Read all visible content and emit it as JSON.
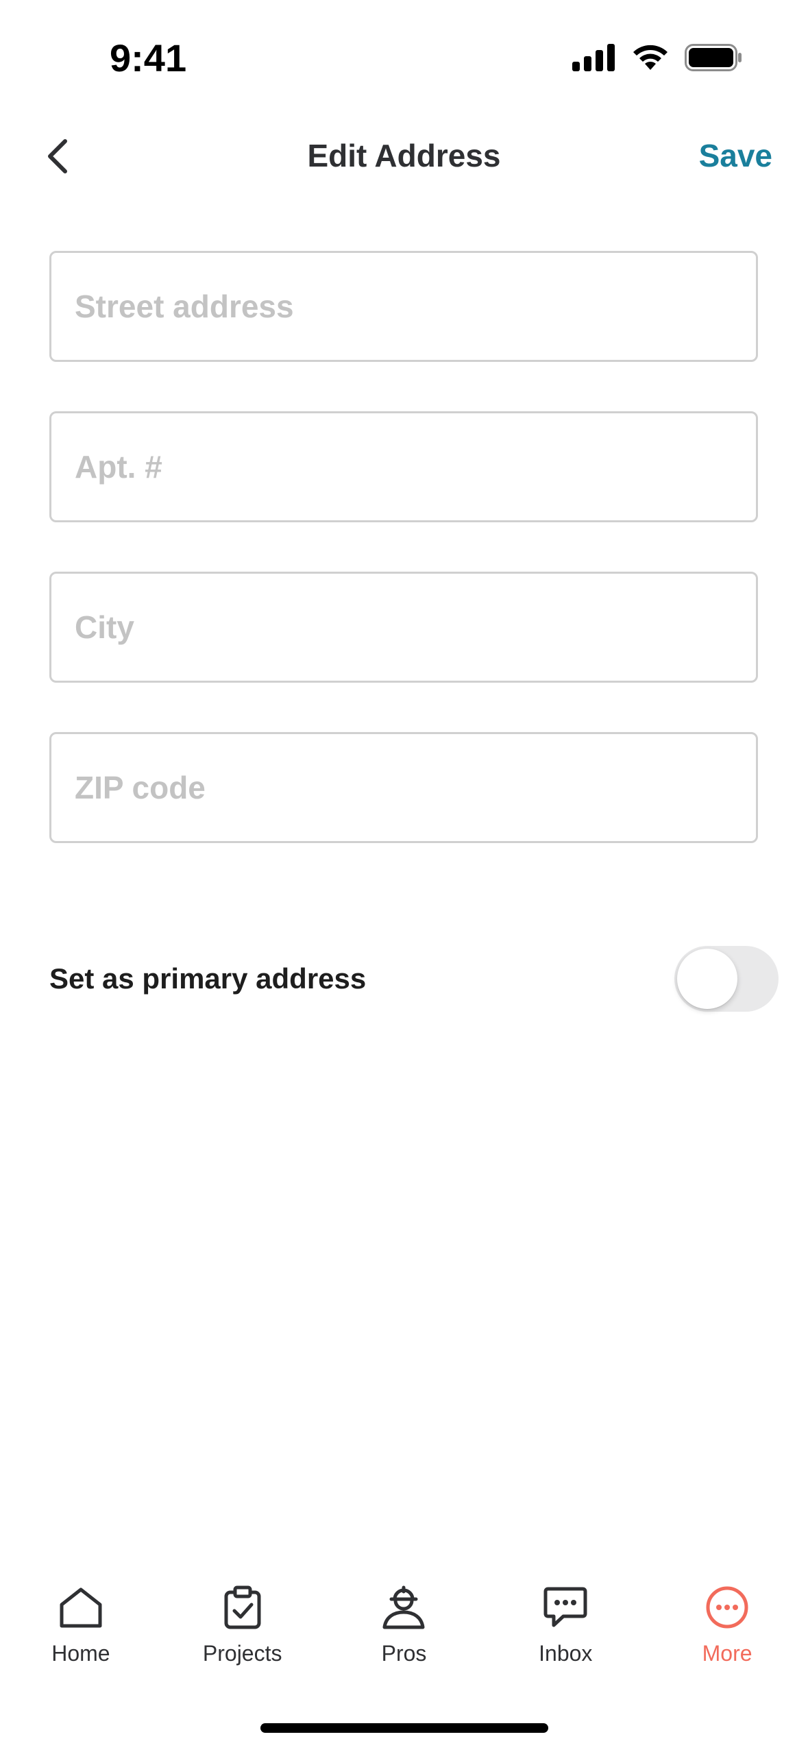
{
  "status_bar": {
    "time": "9:41",
    "icons": [
      "cellular-signal-icon",
      "wifi-icon",
      "battery-icon"
    ]
  },
  "nav": {
    "back_icon": "chevron-left-icon",
    "title": "Edit Address",
    "save_label": "Save"
  },
  "form": {
    "street": {
      "value": "",
      "placeholder": "Street address"
    },
    "apt": {
      "value": "",
      "placeholder": "Apt. #"
    },
    "city": {
      "value": "",
      "placeholder": "City"
    },
    "zip": {
      "value": "",
      "placeholder": "ZIP code"
    }
  },
  "primary_toggle": {
    "label": "Set as primary address",
    "on": false
  },
  "tabs": [
    {
      "label": "Home",
      "icon": "home-icon",
      "active": false
    },
    {
      "label": "Projects",
      "icon": "clipboard-check-icon",
      "active": false
    },
    {
      "label": "Pros",
      "icon": "pro-worker-icon",
      "active": false
    },
    {
      "label": "Inbox",
      "icon": "chat-bubble-icon",
      "active": false
    },
    {
      "label": "More",
      "icon": "more-circle-icon",
      "active": true
    }
  ],
  "colors": {
    "accent": "#1a7f9c",
    "active_tab": "#f26b5b",
    "text": "#2f3033",
    "placeholder": "#c3c3c3",
    "field_border": "#d0d0d0",
    "toggle_off": "#e9e9ea"
  }
}
